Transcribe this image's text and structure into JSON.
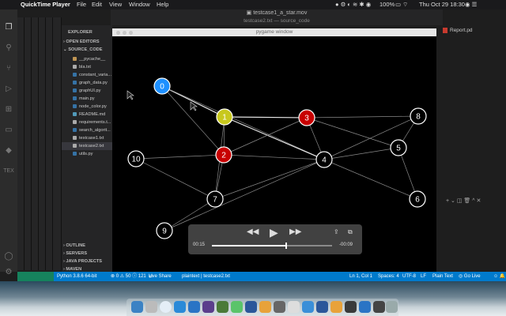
{
  "menubar": {
    "app": "QuickTime Player",
    "items": [
      "File",
      "Edit",
      "View",
      "Window",
      "Help"
    ],
    "battery": "100%",
    "datetime": "Thu Oct 29  18:30"
  },
  "quicktime": {
    "title": "testcase1_a_star.mov"
  },
  "vscode": {
    "title": "testcase2.txt — source_code"
  },
  "sidebar": {
    "title": "EXPLORER",
    "sections": {
      "open_editors": "OPEN EDITORS",
      "source_code": "SOURCE_CODE"
    },
    "files": [
      {
        "name": "__pycache__",
        "color": "#c09553"
      },
      {
        "name": "bla.txt",
        "color": "#aaaaaa"
      },
      {
        "name": "constant_varia...",
        "color": "#3572a5"
      },
      {
        "name": "graph_data.py",
        "color": "#3572a5"
      },
      {
        "name": "graphUI.py",
        "color": "#3572a5"
      },
      {
        "name": "main.py",
        "color": "#3572a5"
      },
      {
        "name": "node_color.py",
        "color": "#3572a5"
      },
      {
        "name": "README.md",
        "color": "#519aba"
      },
      {
        "name": "requirements.t...",
        "color": "#aaaaaa"
      },
      {
        "name": "search_algorit...",
        "color": "#3572a5"
      },
      {
        "name": "testcase1.txt",
        "color": "#aaaaaa"
      },
      {
        "name": "testcase2.txt",
        "color": "#aaaaaa"
      },
      {
        "name": "utils.py",
        "color": "#3572a5"
      }
    ],
    "bottom": [
      "OUTLINE",
      "SERVERS",
      "JAVA PROJECTS",
      "MAVEN"
    ]
  },
  "pygame": {
    "title": "pygame window",
    "nodes": [
      {
        "label": "0",
        "fill": "#1e90ff",
        "text": "#ffffff"
      },
      {
        "label": "1",
        "fill": "#c8c81e",
        "text": "#ffffff"
      },
      {
        "label": "2",
        "fill": "#c80000",
        "text": "#ffffff"
      },
      {
        "label": "3",
        "fill": "#c80000",
        "text": "#ffffff"
      },
      {
        "label": "4",
        "fill": "#000000",
        "text": "#ffffff"
      },
      {
        "label": "5",
        "fill": "#000000",
        "text": "#ffffff"
      },
      {
        "label": "6",
        "fill": "#000000",
        "text": "#ffffff"
      },
      {
        "label": "7",
        "fill": "#000000",
        "text": "#ffffff"
      },
      {
        "label": "8",
        "fill": "#000000",
        "text": "#ffffff"
      },
      {
        "label": "9",
        "fill": "#000000",
        "text": "#ffffff"
      },
      {
        "label": "10",
        "fill": "#000000",
        "text": "#ffffff"
      }
    ]
  },
  "right_panel": {
    "tab": "Report.pd"
  },
  "video": {
    "elapsed": "00:15",
    "remaining": "-00:09",
    "progress": 0.62
  },
  "status": {
    "python": "Python 3.8.6 64-bit",
    "problems": "⊗ 0 ⚠ 50 ⓘ 121",
    "live_share": "Live Share",
    "plaintext": "plaintext | testcase2.txt",
    "position": "Ln 1, Col 1",
    "spaces": "Spaces: 4",
    "encoding": "UTF-8",
    "eol": "LF",
    "language": "Plain Text",
    "go_live": "◎ Go Live"
  },
  "colors": {
    "status_bar": "#007acc",
    "accent_green": "#16825d"
  }
}
